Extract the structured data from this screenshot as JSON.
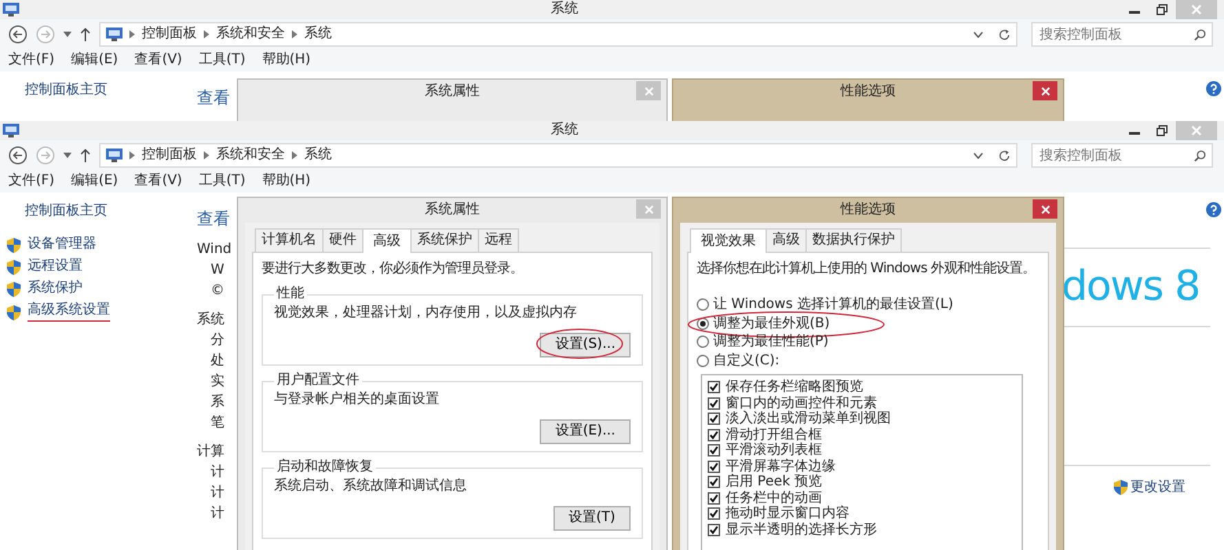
{
  "screens": [
    {
      "window": {
        "title": "系统"
      },
      "breadcrumb": [
        "控制面板",
        "系统和安全",
        "系统"
      ],
      "search": {
        "placeholder": "搜索控制面板"
      },
      "menu": [
        "文件(F)",
        "编辑(E)",
        "查看(V)",
        "工具(T)",
        "帮助(H)"
      ],
      "sidebar": {
        "home": "控制面板主页"
      },
      "main": {
        "heading": "查看"
      },
      "dialogs": [
        {
          "kind": "system_properties",
          "title": "系统属性",
          "active": false
        },
        {
          "kind": "performance",
          "title": "性能选项",
          "active": true
        }
      ]
    },
    {
      "window": {
        "title": "系统"
      },
      "breadcrumb": [
        "控制面板",
        "系统和安全",
        "系统"
      ],
      "search": {
        "placeholder": "搜索控制面板"
      },
      "menu": [
        "文件(F)",
        "编辑(E)",
        "查看(V)",
        "工具(T)",
        "帮助(H)"
      ],
      "sidebar": {
        "home": "控制面板主页",
        "items": [
          {
            "label": "设备管理器",
            "annotated": false
          },
          {
            "label": "远程设置",
            "annotated": false
          },
          {
            "label": "系统保护",
            "annotated": false
          },
          {
            "label": "高级系统设置",
            "annotated": true
          }
        ]
      },
      "main": {
        "heading": "查看",
        "lines": [
          {
            "kind": "section",
            "text": "Wind"
          },
          {
            "kind": "line",
            "text": "W"
          },
          {
            "kind": "line",
            "text": "©"
          },
          {
            "kind": "section",
            "text": "系统"
          },
          {
            "kind": "line",
            "text": "分"
          },
          {
            "kind": "line",
            "text": "处"
          },
          {
            "kind": "line",
            "text": "实"
          },
          {
            "kind": "line",
            "text": "系"
          },
          {
            "kind": "line",
            "text": "笔"
          },
          {
            "kind": "section",
            "text": "计算"
          },
          {
            "kind": "line",
            "text": "计"
          },
          {
            "kind": "line",
            "text": "计"
          },
          {
            "kind": "line",
            "text": "计"
          }
        ],
        "logo": "dows 8",
        "change_link": "更改设置"
      },
      "dialogs": [
        {
          "kind": "system_properties",
          "title": "系统属性",
          "active": false,
          "tabs": [
            {
              "label": "计算机名",
              "selected": false
            },
            {
              "label": "硬件",
              "selected": false
            },
            {
              "label": "高级",
              "selected": true
            },
            {
              "label": "系统保护",
              "selected": false
            },
            {
              "label": "远程",
              "selected": false
            }
          ],
          "intro": "要进行大多数更改，你必须作为管理员登录。",
          "groups": [
            {
              "title": "性能",
              "text": "视觉效果，处理器计划，内存使用，以及虚拟内存",
              "button": "设置(S)...",
              "annotated": true
            },
            {
              "title": "用户配置文件",
              "text": "与登录帐户相关的桌面设置",
              "button": "设置(E)...",
              "annotated": false
            },
            {
              "title": "启动和故障恢复",
              "text": "系统启动、系统故障和调试信息",
              "button": "设置(T)",
              "annotated": false
            }
          ]
        },
        {
          "kind": "performance",
          "title": "性能选项",
          "active": true,
          "tabs": [
            {
              "label": "视觉效果",
              "selected": true
            },
            {
              "label": "高级",
              "selected": false
            },
            {
              "label": "数据执行保护",
              "selected": false
            }
          ],
          "intro": "选择你想在此计算机上使用的 Windows 外观和性能设置。",
          "options": [
            {
              "label": "让 Windows 选择计算机的最佳设置(L)",
              "selected": false,
              "annotated": false
            },
            {
              "label": "调整为最佳外观(B)",
              "selected": true,
              "annotated": true
            },
            {
              "label": "调整为最佳性能(P)",
              "selected": false,
              "annotated": false
            },
            {
              "label": "自定义(C):",
              "selected": false,
              "annotated": false
            }
          ],
          "effects": [
            {
              "label": "保存任务栏缩略图预览",
              "checked": true
            },
            {
              "label": "窗口内的动画控件和元素",
              "checked": true
            },
            {
              "label": "淡入淡出或滑动菜单到视图",
              "checked": true
            },
            {
              "label": "滑动打开组合框",
              "checked": true
            },
            {
              "label": "平滑滚动列表框",
              "checked": true
            },
            {
              "label": "平滑屏幕字体边缘",
              "checked": true
            },
            {
              "label": "启用 Peek 预览",
              "checked": true
            },
            {
              "label": "任务栏中的动画",
              "checked": true
            },
            {
              "label": "拖动时显示窗口内容",
              "checked": true
            },
            {
              "label": "显示半透明的选择长方形",
              "checked": true
            }
          ]
        }
      ]
    }
  ]
}
